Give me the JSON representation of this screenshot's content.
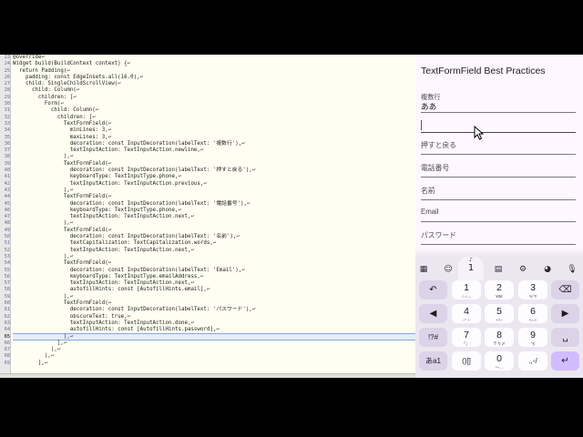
{
  "editor": {
    "lines": [
      {
        "n": "23",
        "text": "@override↩"
      },
      {
        "n": "24",
        "text": "Widget build(BuildContext context) {↩"
      },
      {
        "n": "25",
        "text": "  return Padding(↩"
      },
      {
        "n": "26",
        "text": "    padding: const EdgeInsets.all(16.0),↩"
      },
      {
        "n": "27",
        "text": "    child: SingleChildScrollView(↩"
      },
      {
        "n": "28",
        "text": "      child: Column(↩"
      },
      {
        "n": "29",
        "text": "        children: [↩"
      },
      {
        "n": "30",
        "text": "          Form(↩"
      },
      {
        "n": "31",
        "text": "            child: Column(↩"
      },
      {
        "n": "32",
        "text": "              children: [↩"
      },
      {
        "n": "33",
        "text": "                TextFormField(↩"
      },
      {
        "n": "34",
        "text": "                  minLines: 3,↩"
      },
      {
        "n": "35",
        "text": "                  maxLines: 3,↩"
      },
      {
        "n": "36",
        "text": "                  decoration: const InputDecoration(labelText: '複数行'),↩"
      },
      {
        "n": "37",
        "text": "                  textInputAction: TextInputAction.newline,↩"
      },
      {
        "n": "38",
        "text": "                ),↩"
      },
      {
        "n": "39",
        "text": "                TextFormField(↩"
      },
      {
        "n": "40",
        "text": "                  decoration: const InputDecoration(labelText: '押すと戻る'),↩"
      },
      {
        "n": "41",
        "text": "                  keyboardType: TextInputType.phone,↩"
      },
      {
        "n": "42",
        "text": "                  textInputAction: TextInputAction.previous,↩"
      },
      {
        "n": "43",
        "text": "                ),↩"
      },
      {
        "n": "44",
        "text": "                TextFormField(↩"
      },
      {
        "n": "45",
        "text": "                  decoration: const InputDecoration(labelText: '電話番号'),↩"
      },
      {
        "n": "46",
        "text": "                  keyboardType: TextInputType.phone,↩"
      },
      {
        "n": "47",
        "text": "                  textInputAction: TextInputAction.next,↩"
      },
      {
        "n": "48",
        "text": "                ),↩"
      },
      {
        "n": "49",
        "text": "                TextFormField(↩"
      },
      {
        "n": "50",
        "text": "                  decoration: const InputDecoration(labelText: '名前'),↩"
      },
      {
        "n": "51",
        "text": "                  textCapitalization: TextCapitalization.words,↩"
      },
      {
        "n": "52",
        "text": "                  textInputAction: TextInputAction.next,↩"
      },
      {
        "n": "53",
        "text": "                ),↩"
      },
      {
        "n": "54",
        "text": "                TextFormField(↩"
      },
      {
        "n": "55",
        "text": "                  decoration: const InputDecoration(labelText: 'Email'),↩"
      },
      {
        "n": "56",
        "text": "                  keyboardType: TextInputType.emailAddress,↩"
      },
      {
        "n": "57",
        "text": "                  textInputAction: TextInputAction.next,↩"
      },
      {
        "n": "58",
        "text": "                  autofillHints: const [AutofillHints.email],↩"
      },
      {
        "n": "59",
        "text": "                ),↩"
      },
      {
        "n": "60",
        "text": "                TextFormField(↩"
      },
      {
        "n": "61",
        "text": "                  decoration: const InputDecoration(labelText: 'パスワード'),↩"
      },
      {
        "n": "62",
        "text": "                  obscureText: true,↩"
      },
      {
        "n": "63",
        "text": "                  textInputAction: TextInputAction.done,↩"
      },
      {
        "n": "64",
        "text": "                  autofillHints: const [AutofillHints.password],↩"
      },
      {
        "n": "65",
        "text": "                ),↩"
      },
      {
        "n": "66",
        "text": "              ],↩"
      },
      {
        "n": "67",
        "text": "            ),↩"
      },
      {
        "n": "68",
        "text": "          ),↩"
      },
      {
        "n": "69",
        "text": "        ],↩"
      }
    ],
    "current_line": "65"
  },
  "phone": {
    "title": "TextFormField Best Practices",
    "fields": [
      {
        "label": "複数行",
        "value": "ああ"
      },
      {
        "label": "",
        "value": ""
      },
      {
        "label": "押すと戻る",
        "value": ""
      },
      {
        "label": "電話番号",
        "value": ""
      },
      {
        "label": "名前",
        "value": ""
      },
      {
        "label": "Email",
        "value": ""
      },
      {
        "label": "パスワード",
        "value": ""
      }
    ]
  },
  "keyboard": {
    "toolbar_icons": [
      "grid-icon",
      "sticker-icon",
      "clipboard-icon",
      "settings-icon",
      "palette-icon",
      "mic-icon"
    ],
    "popup_key": "1",
    "popup_sub": "♪",
    "keys": [
      {
        "name": "undo",
        "main": "↶",
        "sub": ""
      },
      {
        "name": "1",
        "main": "1",
        "sub": "☆♪→"
      },
      {
        "name": "2",
        "main": "2",
        "sub": "¥$€"
      },
      {
        "name": "3",
        "main": "3",
        "sub": "%°#"
      },
      {
        "name": "backspace",
        "main": "⌫",
        "sub": ""
      },
      {
        "name": "left",
        "main": "◀",
        "sub": ""
      },
      {
        "name": "4",
        "main": "4",
        "sub": "○*・"
      },
      {
        "name": "5",
        "main": "5",
        "sub": "+×÷"
      },
      {
        "name": "6",
        "main": "6",
        "sub": "<=>"
      },
      {
        "name": "right",
        "main": "▶",
        "sub": ""
      },
      {
        "name": "symbols",
        "main": "!?#",
        "sub": ""
      },
      {
        "name": "7",
        "main": "7",
        "sub": "「」:"
      },
      {
        "name": "8",
        "main": "8",
        "sub": "〒々〆"
      },
      {
        "name": "9",
        "main": "9",
        "sub": "^|\\"
      },
      {
        "name": "space",
        "main": "␣",
        "sub": ""
      },
      {
        "name": "mode",
        "main": "あa1",
        "sub": ""
      },
      {
        "name": "brackets",
        "main": "()[]",
        "sub": ""
      },
      {
        "name": "0",
        "main": "0",
        "sub": "〜…"
      },
      {
        "name": "punct",
        "main": ".,-/",
        "sub": ""
      },
      {
        "name": "enter",
        "main": "↵",
        "sub": ""
      }
    ]
  }
}
